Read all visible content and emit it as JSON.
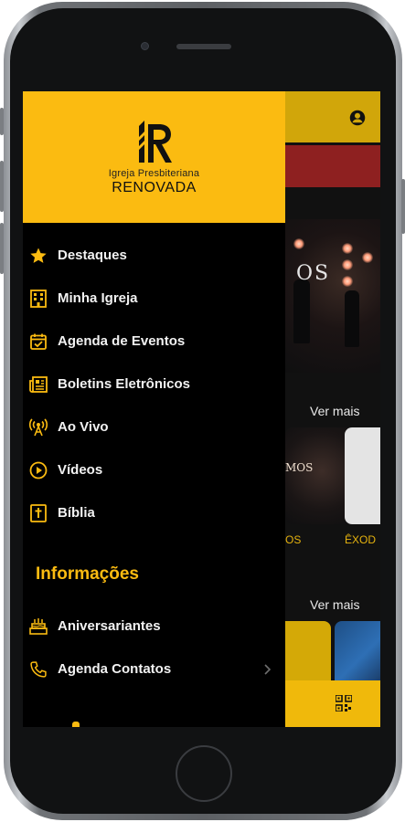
{
  "drawer": {
    "brand": {
      "line1": "Igreja Presbiteriana",
      "line2": "RENOVADA"
    },
    "items": [
      {
        "label": "Destaques",
        "icon": "star-icon"
      },
      {
        "label": "Minha Igreja",
        "icon": "building-icon"
      },
      {
        "label": "Agenda de Eventos",
        "icon": "calendar-check-icon"
      },
      {
        "label": "Boletins Eletrônicos",
        "icon": "newspaper-icon"
      },
      {
        "label": "Ao Vivo",
        "icon": "broadcast-tower-icon"
      },
      {
        "label": "Vídeos",
        "icon": "play-circle-icon"
      },
      {
        "label": "Bíblia",
        "icon": "bible-icon"
      }
    ],
    "section_title": "Informações",
    "info_items": [
      {
        "label": "Aniversariantes",
        "icon": "birthday-cake-icon"
      },
      {
        "label": "Agenda Contatos",
        "icon": "phone-icon"
      }
    ]
  },
  "background": {
    "stage_text": "OS",
    "ver_mais_1": "Ver mais",
    "ver_mais_2": "Ver mais",
    "thumb_text": "MOS",
    "caption_1": "OS",
    "caption_2": "ÊXOD"
  },
  "colors": {
    "accent": "#fbbb11",
    "drawer_bg": "#000000",
    "red_banner": "#8e2020",
    "caption": "#e5b20e"
  }
}
